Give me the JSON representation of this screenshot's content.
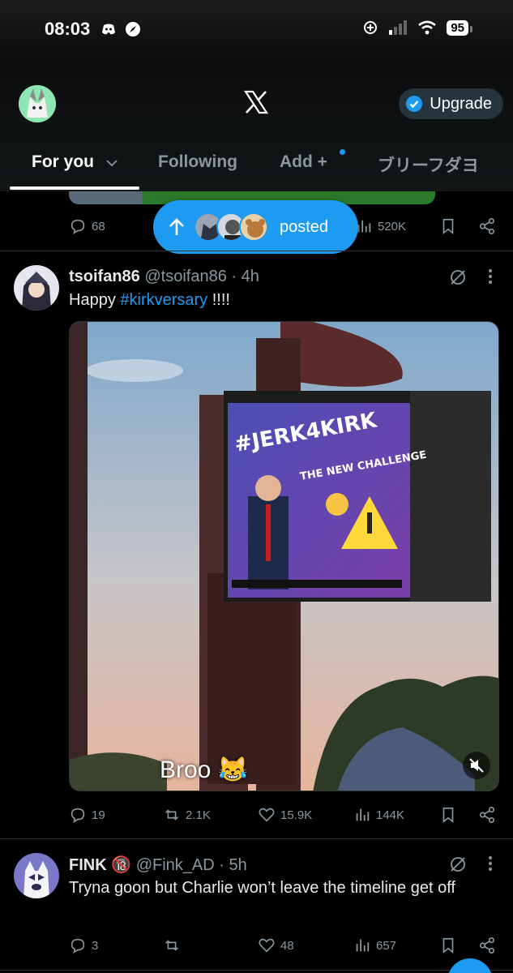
{
  "status": {
    "time": "08:03",
    "battery": "95"
  },
  "header": {
    "upgrade_label": "Upgrade"
  },
  "tabs": [
    {
      "label": "For you"
    },
    {
      "label": "Following"
    },
    {
      "label": "Add +"
    },
    {
      "label": "ブリーフダヨ"
    }
  ],
  "prev_tweet": {
    "replies": "68",
    "views": "520K"
  },
  "new_posts_pill": {
    "label": "posted"
  },
  "tweet1": {
    "name": "tsoifan86",
    "handle_time": "@tsoifan86 · 4h",
    "text_prefix": "Happy ",
    "hashtag": "#kirkversary",
    "text_suffix": " !!!!",
    "billboard_title": "#JERK4KIRK",
    "billboard_subtitle": "THE NEW CHALLENGE",
    "caption": "Broo 😹",
    "replies": "19",
    "reposts": "2.1K",
    "likes": "15.9K",
    "views": "144K"
  },
  "tweet2": {
    "name": "FINK 🔞",
    "handle_time": "@Fink_AD · 5h",
    "text": "Tryna goon but Charlie won’t leave the timeline get off",
    "replies": "3",
    "likes": "48",
    "views": "657"
  },
  "colors": {
    "accent": "#1d9bf0",
    "background": "#000000",
    "secondary_text": "#8b979f"
  }
}
